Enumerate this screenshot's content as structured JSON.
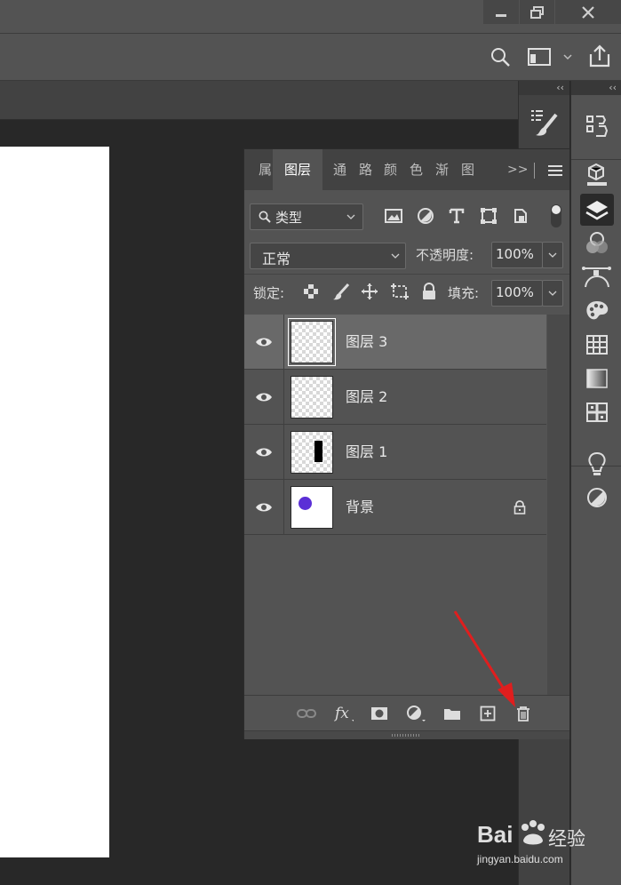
{
  "panel": {
    "tabs": [
      "属",
      "图层",
      "通",
      "路",
      "颜",
      "色",
      "渐",
      "图"
    ],
    "overflow": ">>",
    "filter_kind": "类型",
    "blend_mode": "正常",
    "opacity_label": "不透明度:",
    "opacity_value": "100%",
    "lock_label": "锁定:",
    "fill_label": "填充:",
    "fill_value": "100%"
  },
  "layers": [
    {
      "name": "图层 3",
      "selected": true
    },
    {
      "name": "图层 2",
      "selected": false
    },
    {
      "name": "图层 1",
      "selected": false
    },
    {
      "name": "背景",
      "selected": false
    }
  ],
  "dock": {
    "collapse": "‹‹"
  },
  "watermark": {
    "brand": "Bai",
    "brand_suffix": "经验",
    "url": "jingyan.baidu.com"
  },
  "colors": {
    "background": "#282828",
    "panel": "#535353",
    "selected_layer": "#696969",
    "background_dot": "#5b2fd6",
    "arrow": "#e01e1e"
  }
}
